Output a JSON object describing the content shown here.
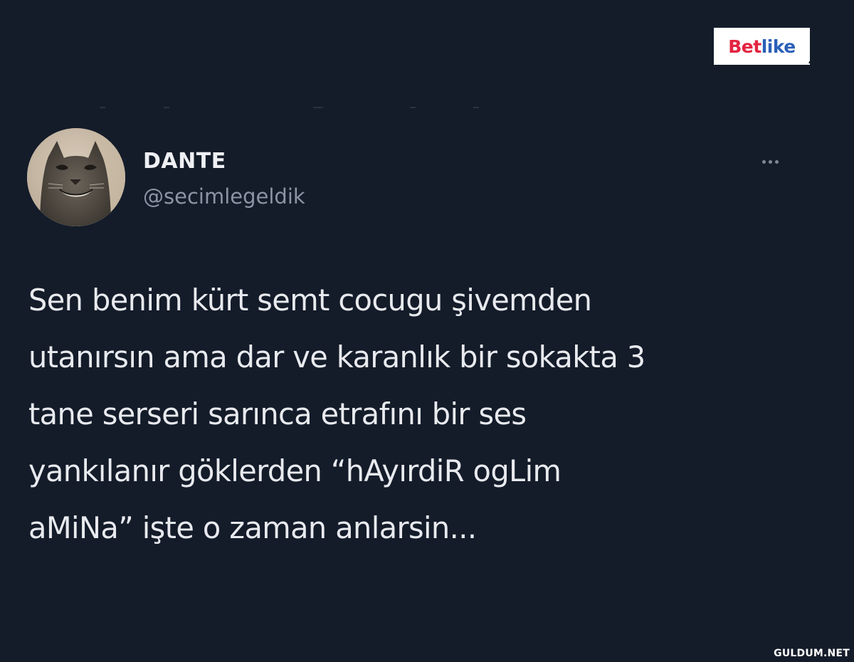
{
  "sponsor": {
    "logo_text_a": "Bet",
    "logo_text_b": "like",
    "colors": {
      "a": "#e2233f",
      "b": "#2a5fb8"
    }
  },
  "tweet": {
    "display_name": "DANTE",
    "handle": "@secimlegeldik",
    "avatar_icon": "cat-avatar-icon",
    "more_icon": "more-options-icon",
    "text": "Sen benim kürt semt cocugu şivemden\nutanırsın ama dar ve karanlık bir sokakta 3\ntane serseri sarınca etrafını bir ses\nyankılanır göklerden “hAyırdiR ogLim\naMiNa” işte o zaman anlarsin..."
  },
  "watermark": "GULDUM.NET",
  "colors": {
    "background": "#141c2a",
    "text": "#e8eaee",
    "handle": "#8b95a3"
  }
}
